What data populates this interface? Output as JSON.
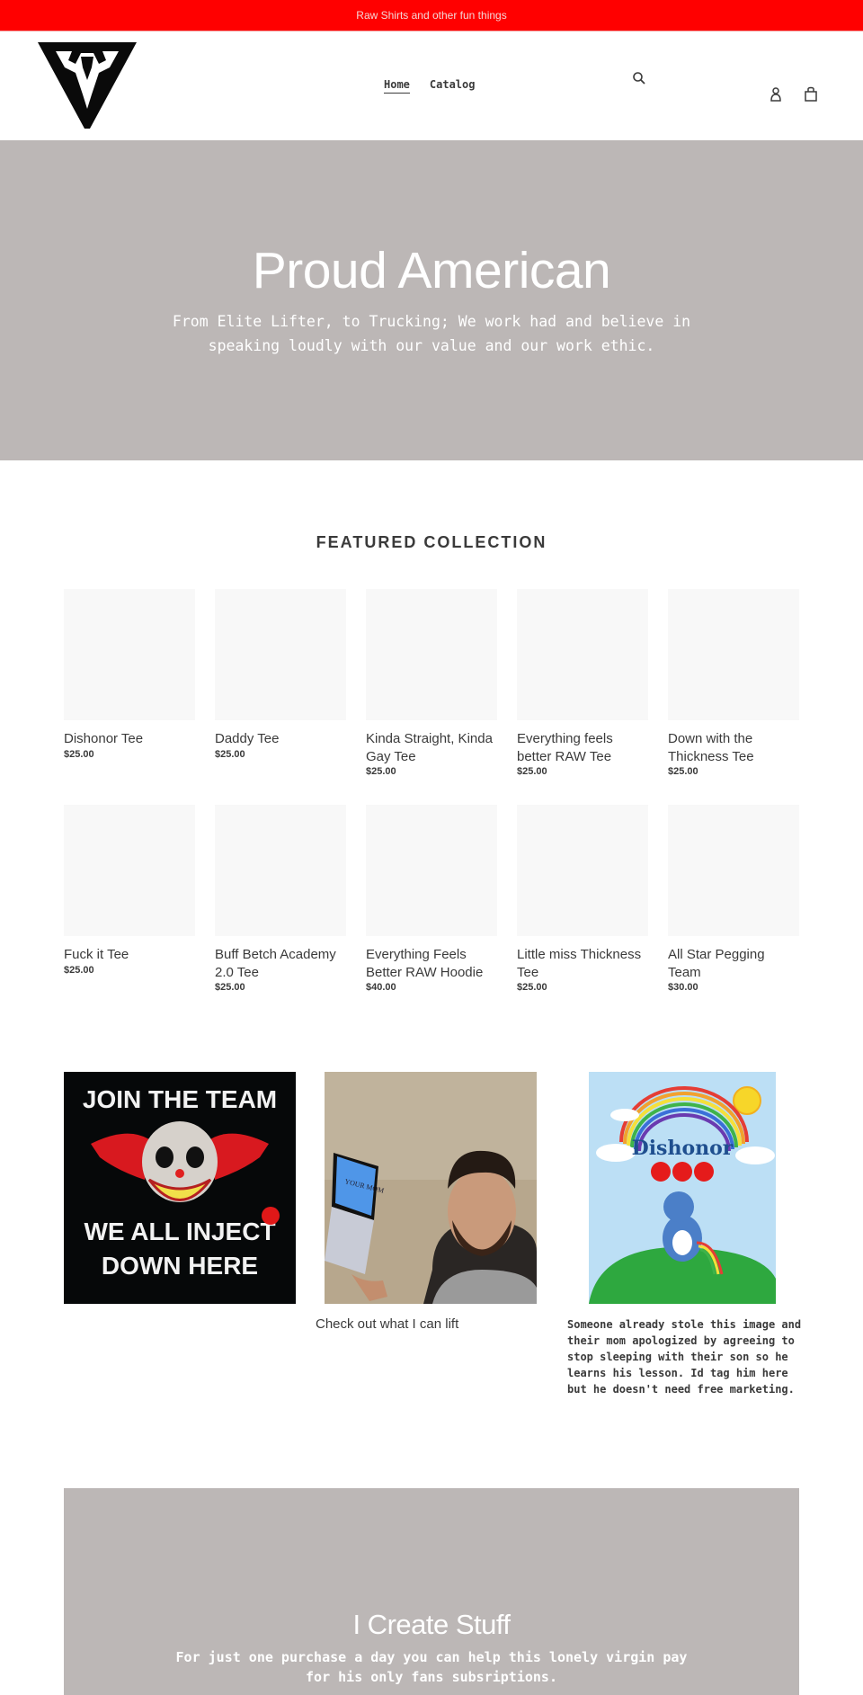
{
  "announcement": {
    "text": "Raw Shirts and other fun things",
    "background": "#ff0000"
  },
  "header": {
    "logo_alt": "brand-logo",
    "nav": [
      {
        "label": "Home",
        "active": true
      },
      {
        "label": "Catalog",
        "active": false
      }
    ],
    "icons": {
      "search": "search-icon",
      "account": "account-icon",
      "cart": "cart-icon"
    }
  },
  "hero": {
    "title": "Proud American",
    "subtitle": "From Elite Lifter, to Trucking; We work had and believe in speaking loudly with our value and our work ethic.",
    "background": "#bcb7b6"
  },
  "featured": {
    "title": "FEATURED COLLECTION",
    "products": [
      {
        "title": "Dishonor Tee",
        "price": "$25.00"
      },
      {
        "title": "Daddy Tee",
        "price": "$25.00"
      },
      {
        "title": "Kinda Straight, Kinda Gay Tee",
        "price": "$25.00"
      },
      {
        "title": "Everything feels better RAW Tee",
        "price": "$25.00"
      },
      {
        "title": "Down with the Thickness Tee",
        "price": "$25.00"
      },
      {
        "title": "Fuck it Tee",
        "price": "$25.00"
      },
      {
        "title": "Buff Betch Academy 2.0 Tee",
        "price": "$25.00"
      },
      {
        "title": "Everything Feels Better RAW Hoodie",
        "price": "$40.00"
      },
      {
        "title": "Little miss Thickness Tee",
        "price": "$25.00"
      },
      {
        "title": "All Star Pegging Team",
        "price": "$30.00"
      }
    ]
  },
  "gallery": {
    "image1": {
      "line1": "JOIN THE TEAM",
      "line2": "WE ALL INJECT",
      "line3": "DOWN HERE"
    },
    "image2": {
      "screen_text": "YOUR MOM",
      "caption": "Check out what I can lift"
    },
    "image3": {
      "art_text": "Dishonor",
      "caption": "Someone already stole this image and their mom apologized by agreeing to stop sleeping with their son so he learns his lesson. Id tag him here but he doesn't need free marketing."
    }
  },
  "cta": {
    "title": "I Create Stuff",
    "text": "For just one purchase a day you can help this lonely virgin pay for his only fans subsriptions."
  }
}
